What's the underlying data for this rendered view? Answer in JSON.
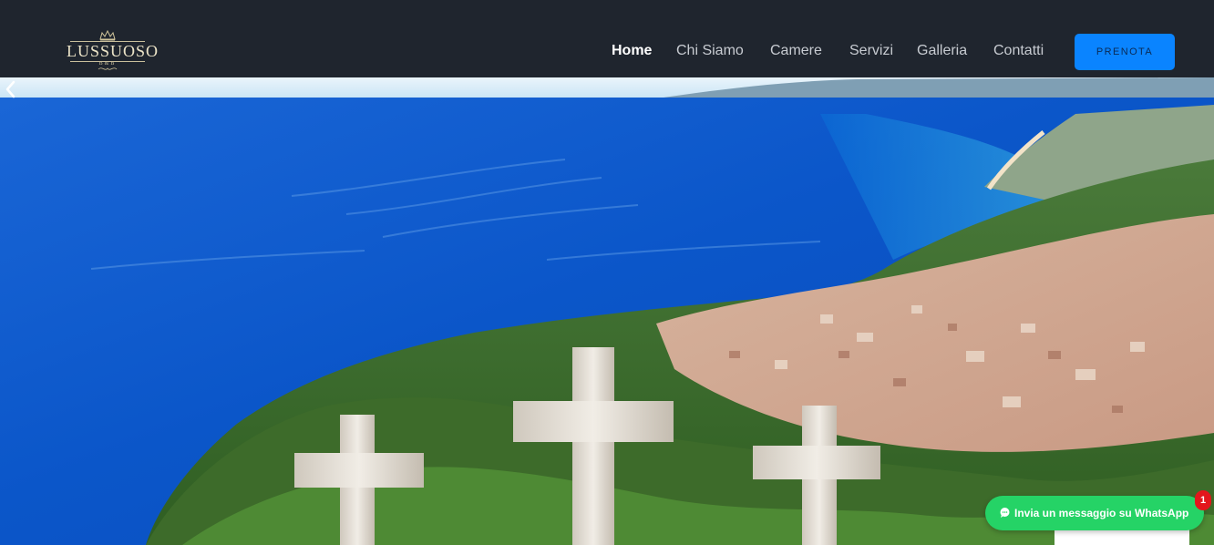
{
  "header": {
    "logo": {
      "name": "LUSSUOSO",
      "sub": "B&B"
    },
    "nav": [
      {
        "label": "Home",
        "active": true
      },
      {
        "label": "Chi Siamo",
        "active": false
      },
      {
        "label": "Camere",
        "active": false
      },
      {
        "label": "Servizi",
        "active": false
      },
      {
        "label": "Galleria",
        "active": false
      },
      {
        "label": "Contatti",
        "active": false
      }
    ],
    "cta_label": "PRENOTA"
  },
  "hero": {
    "prev_icon": "chevron-left-icon"
  },
  "whatsapp": {
    "label": "Invia un messaggio su WhatsApp",
    "badge": "1",
    "icon": "whatsapp-icon"
  },
  "colors": {
    "header_bg": "#1f252e",
    "accent": "#0a84ff",
    "whatsapp": "#25d366",
    "badge": "#e3161c"
  }
}
